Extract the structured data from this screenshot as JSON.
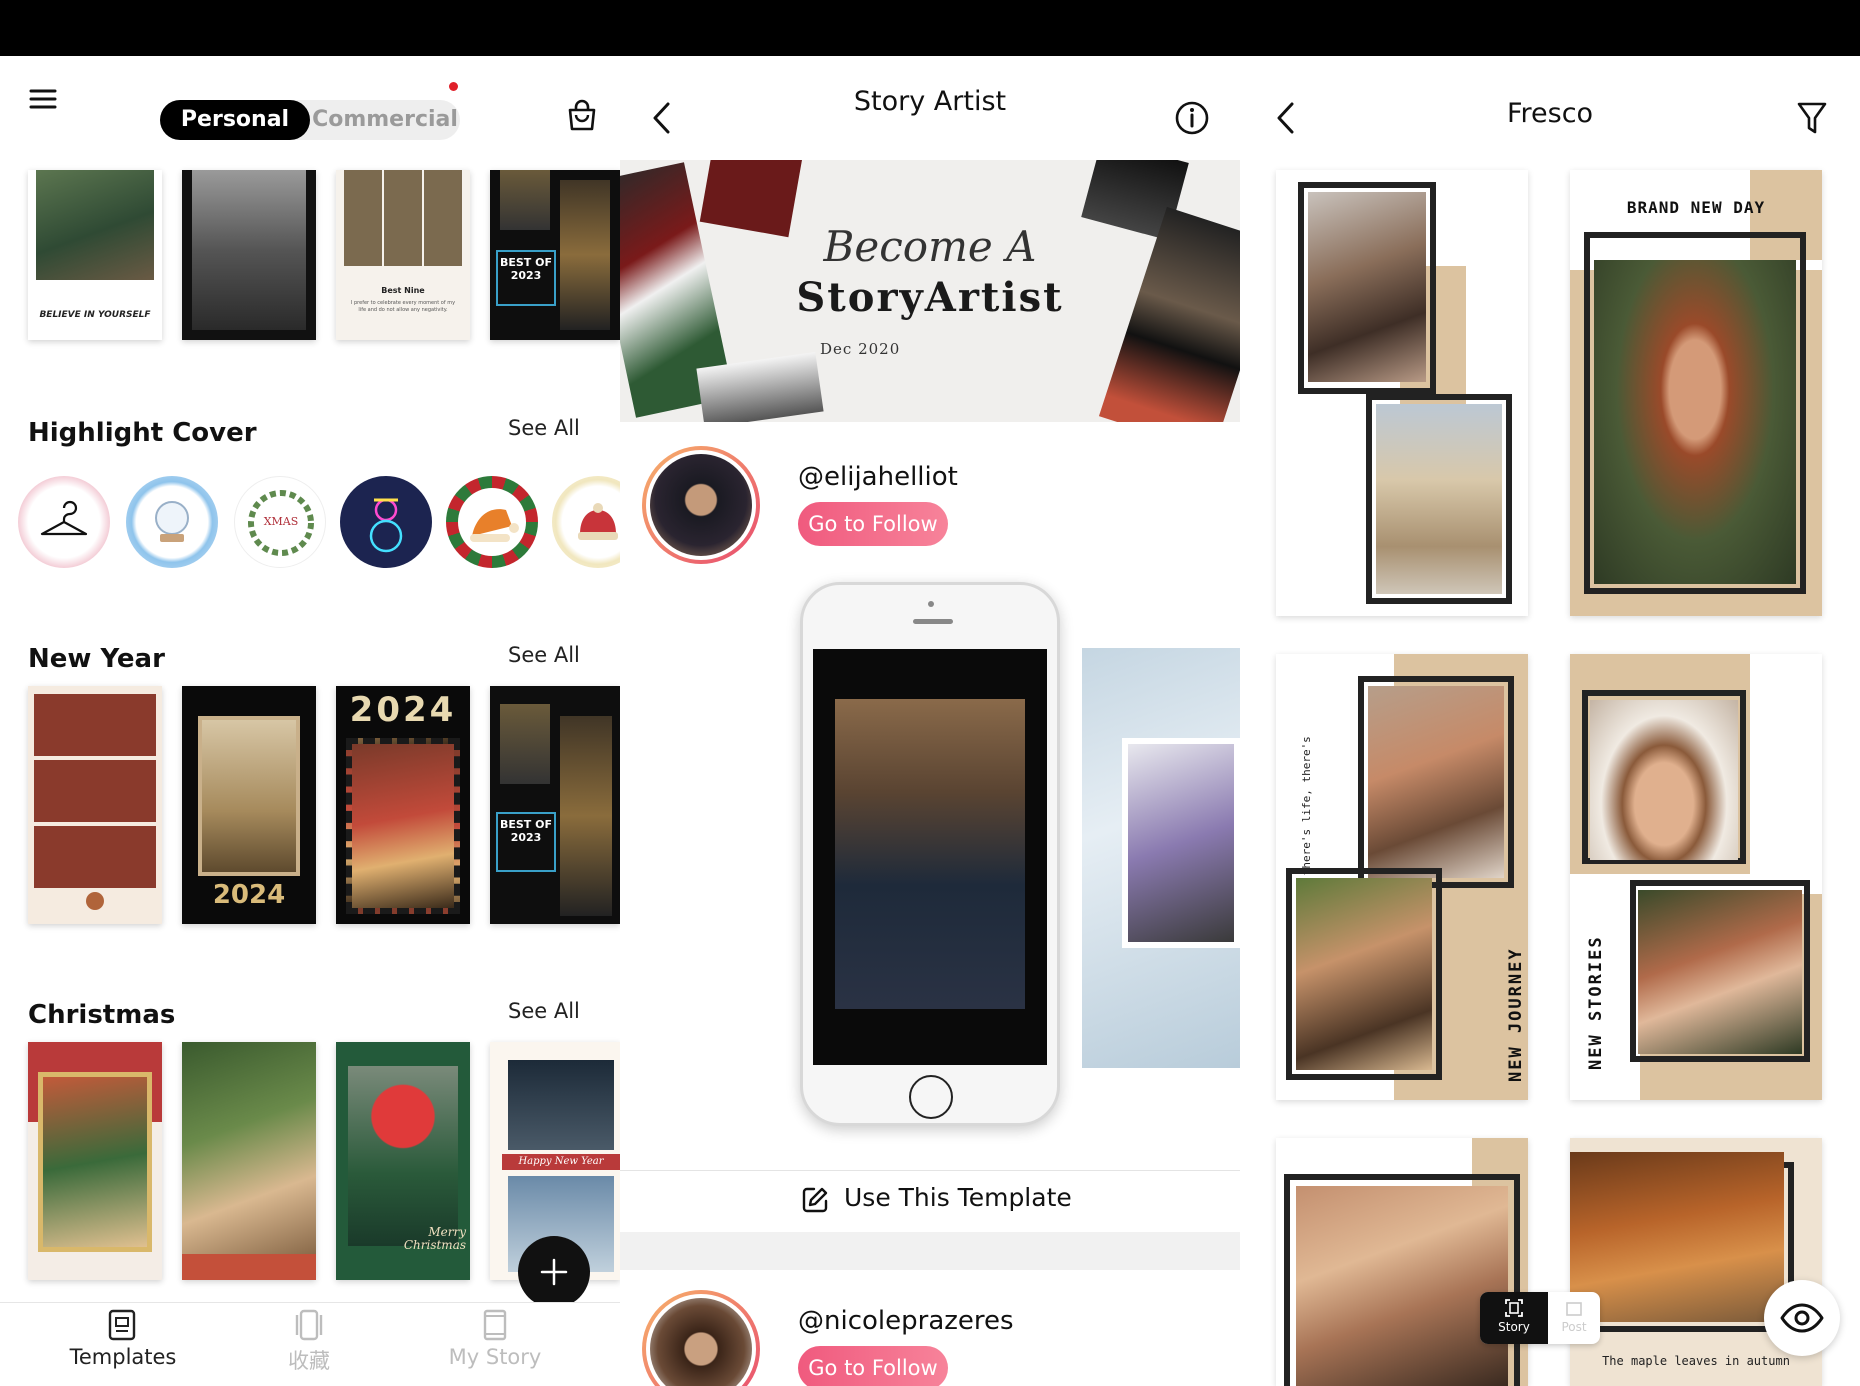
{
  "panel_left": {
    "tabs": {
      "personal": "Personal",
      "commercial": "Commercial"
    },
    "top_thumbs": {
      "t1_caption": "BELIEVE IN YOURSELF",
      "t3_title": "Best Nine",
      "t3_text": "I prefer to celebrate every moment of my life and do not allow any negativity.",
      "t4_text": "BEST OF 2023"
    },
    "sections": [
      {
        "title": "Highlight Cover",
        "see_all": "See All"
      },
      {
        "title": "New Year",
        "see_all": "See All"
      },
      {
        "title": "Christmas",
        "see_all": "See All"
      }
    ],
    "highlight": {
      "xmas_label": "XMAS"
    },
    "new_year": {
      "t2_year": "2024",
      "t3_year": "2024",
      "t4_text": "BEST OF 2023"
    },
    "christmas": {
      "t3_text": "Merry Christmas",
      "t4_text": "Happy New Year"
    },
    "nav": [
      {
        "label": "Templates"
      },
      {
        "label": "收藏"
      },
      {
        "label": "My Story"
      }
    ],
    "colors": {
      "active_tab": "#000000",
      "notification_dot": "#e0202a"
    }
  },
  "panel_middle": {
    "title": "Story Artist",
    "banner": {
      "script_text": "Become A",
      "main_text": "StoryArtist",
      "date": "Dec 2020"
    },
    "creators": [
      {
        "handle": "@elijahelliot",
        "follow": "Go to Follow"
      },
      {
        "handle": "@nicoleprazeres",
        "follow": "Go to Follow"
      }
    ],
    "use_template": "Use This Template"
  },
  "panel_right": {
    "title": "Fresco",
    "cards": {
      "c2_title": "BRAND NEW DAY",
      "c3_side_text": "while there's life, there's hope.",
      "c3_vertical": "NEW JOURNEY",
      "c4_vertical": "NEW STORIES",
      "c6_caption": "The maple leaves in autumn"
    },
    "toggle": {
      "story": "Story",
      "post": "Post"
    }
  }
}
